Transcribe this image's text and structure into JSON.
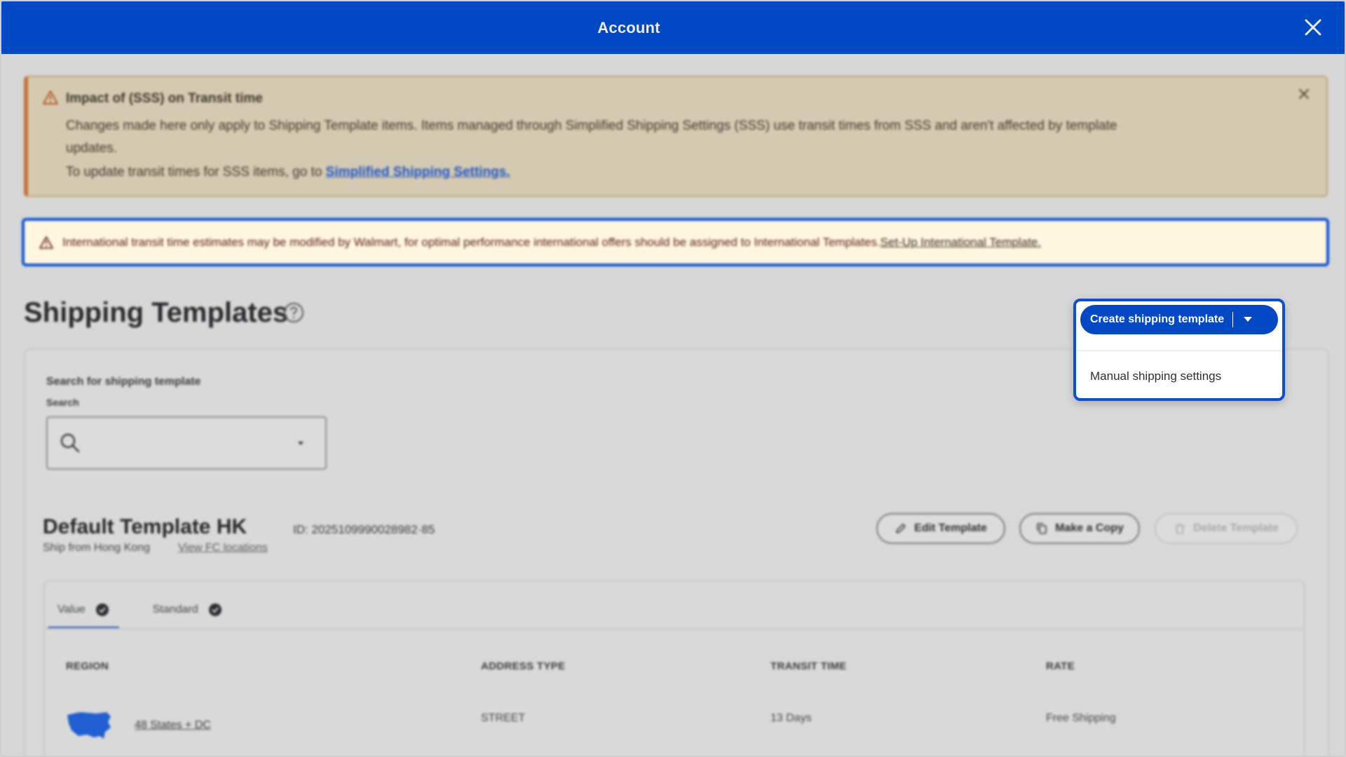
{
  "header": {
    "title": "Account",
    "close_icon": "close-icon"
  },
  "sss_banner": {
    "title": "Impact of (SSS) on Transit time",
    "body": "Changes made here only apply to Shipping Template items. Items managed through Simplified Shipping Settings (SSS) use transit times from SSS and aren't affected by template updates.",
    "cta_prefix": "To update transit times for SSS items, go to",
    "cta_link": "Simplified Shipping Settings.",
    "icon": "warning-icon",
    "accent": "#c6733b"
  },
  "intl_banner": {
    "message": "International transit time estimates may be modified by Walmart, for optimal performance international offers should be assigned to International Templates.",
    "link": "Set-Up International Template.",
    "icon": "warning-icon",
    "border_color": "#0a4fd6"
  },
  "page": {
    "title": "Shipping Templates",
    "help_icon": "help-circle-icon"
  },
  "search": {
    "heading": "Search for shipping template",
    "label": "Search",
    "value": "",
    "placeholder": ""
  },
  "template": {
    "name": "Default Template HK",
    "id_text": "ID: 2025109990028982·85",
    "ship_from": "Ship from Hong Kong",
    "fc_link": "View FC locations",
    "actions": {
      "edit": "Edit Template",
      "copy": "Make a Copy",
      "delete": "Delete Template"
    }
  },
  "tabs": [
    {
      "label": "Value",
      "active": true
    },
    {
      "label": "Standard",
      "active": false
    }
  ],
  "table": {
    "headers": {
      "region": "REGION",
      "address_type": "ADDRESS TYPE",
      "transit_time": "TRANSIT TIME",
      "rate": "RATE"
    },
    "rows": [
      {
        "region": "48 States + DC",
        "address_type": "STREET",
        "transit_time": "13 Days",
        "rate": "Free Shipping"
      }
    ]
  },
  "dropdown": {
    "button_label": "Create shipping template",
    "items": [
      "Manual shipping settings"
    ],
    "accent": "#0048c4"
  }
}
